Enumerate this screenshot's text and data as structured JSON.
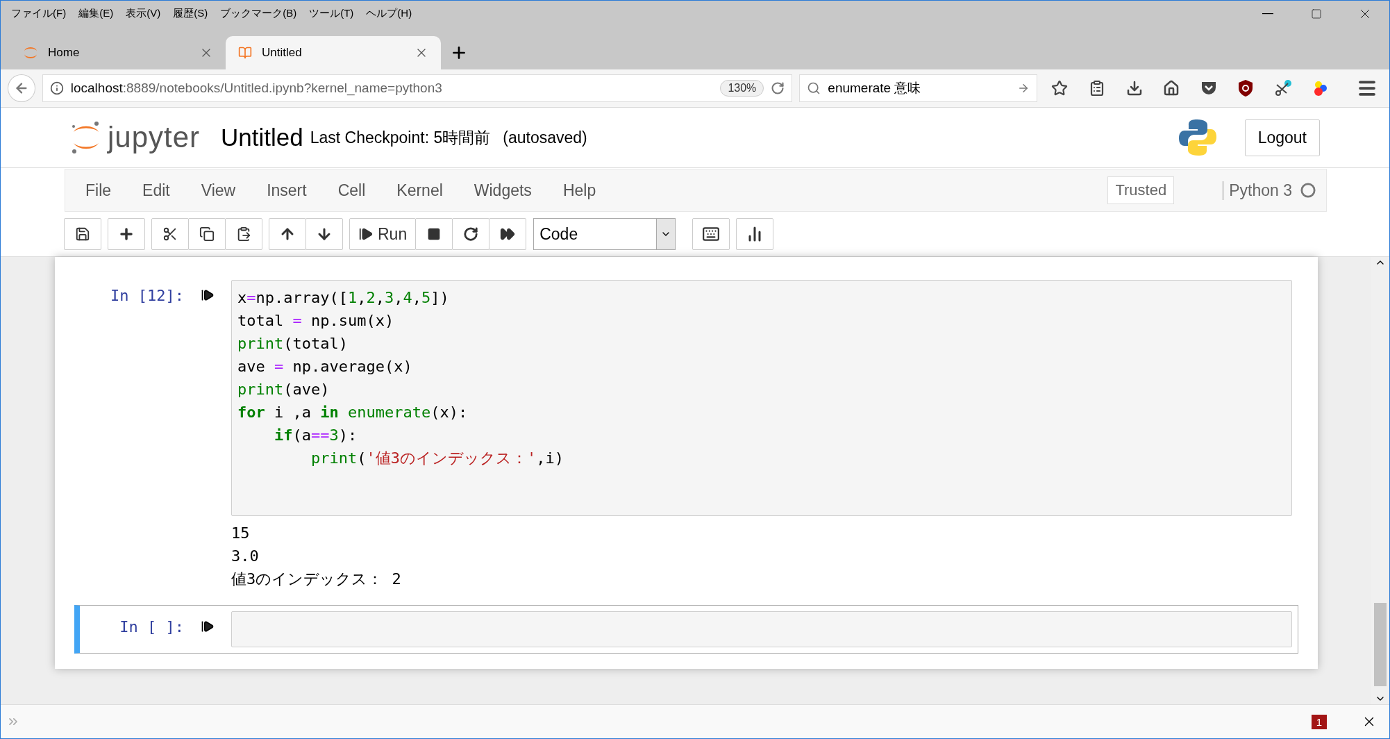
{
  "browser": {
    "menu": [
      "ファイル(F)",
      "編集(E)",
      "表示(V)",
      "履歴(S)",
      "ブックマーク(B)",
      "ツール(T)",
      "ヘルプ(H)"
    ],
    "tabs": [
      {
        "title": "Home",
        "selected": false
      },
      {
        "title": "Untitled",
        "selected": true
      }
    ],
    "url": {
      "host": "localhost",
      "rest": ":8889/notebooks/Untitled.ipynb?kernel_name=python3"
    },
    "zoom": "130%",
    "search": {
      "value": "enumerate 意味"
    }
  },
  "notebook": {
    "logo": "jupyter",
    "title": "Untitled",
    "checkpoint": "Last Checkpoint: 5時間前",
    "autosave": "(autosaved)",
    "logout": "Logout",
    "menu": [
      "File",
      "Edit",
      "View",
      "Insert",
      "Cell",
      "Kernel",
      "Widgets",
      "Help"
    ],
    "trusted": "Trusted",
    "kernel": "Python 3",
    "run": "Run",
    "cell_type": "Code"
  },
  "cells": [
    {
      "prompt": "In [12]:",
      "selected": false,
      "code": [
        [
          {
            "text": "x",
            "kind": "plain"
          },
          {
            "text": "=",
            "kind": "op"
          },
          {
            "text": "np.array([",
            "kind": "plain"
          },
          {
            "text": "1",
            "kind": "num"
          },
          {
            "text": ",",
            "kind": "plain"
          },
          {
            "text": "2",
            "kind": "num"
          },
          {
            "text": ",",
            "kind": "plain"
          },
          {
            "text": "3",
            "kind": "num"
          },
          {
            "text": ",",
            "kind": "plain"
          },
          {
            "text": "4",
            "kind": "num"
          },
          {
            "text": ",",
            "kind": "plain"
          },
          {
            "text": "5",
            "kind": "num"
          },
          {
            "text": "])",
            "kind": "plain"
          }
        ],
        [
          {
            "text": "total ",
            "kind": "plain"
          },
          {
            "text": "=",
            "kind": "op"
          },
          {
            "text": " np.sum(x)",
            "kind": "plain"
          }
        ],
        [
          {
            "text": "print",
            "kind": "builtin"
          },
          {
            "text": "(total)",
            "kind": "plain"
          }
        ],
        [
          {
            "text": "ave ",
            "kind": "plain"
          },
          {
            "text": "=",
            "kind": "op"
          },
          {
            "text": " np.average(x)",
            "kind": "plain"
          }
        ],
        [
          {
            "text": "print",
            "kind": "builtin"
          },
          {
            "text": "(ave)",
            "kind": "plain"
          }
        ],
        [
          {
            "text": "for",
            "kind": "kw"
          },
          {
            "text": " i ,a ",
            "kind": "plain"
          },
          {
            "text": "in",
            "kind": "kw"
          },
          {
            "text": " enumerate",
            "kind": "builtin"
          },
          {
            "text": "(x):",
            "kind": "plain"
          }
        ],
        [
          {
            "text": "    if",
            "kind": "kw"
          },
          {
            "text": "(a",
            "kind": "plain"
          },
          {
            "text": "==",
            "kind": "op"
          },
          {
            "text": "3",
            "kind": "num"
          },
          {
            "text": "):",
            "kind": "plain"
          }
        ],
        [
          {
            "text": "        print",
            "kind": "builtin"
          },
          {
            "text": "(",
            "kind": "plain"
          },
          {
            "text": "'値3のインデックス：'",
            "kind": "str"
          },
          {
            "text": ",i)",
            "kind": "plain"
          }
        ]
      ],
      "outputs": [
        "15",
        "3.0",
        "値3のインデックス： 2"
      ]
    },
    {
      "prompt": "In [ ]:",
      "selected": true
    }
  ],
  "status_bar": {
    "badge": "1"
  }
}
